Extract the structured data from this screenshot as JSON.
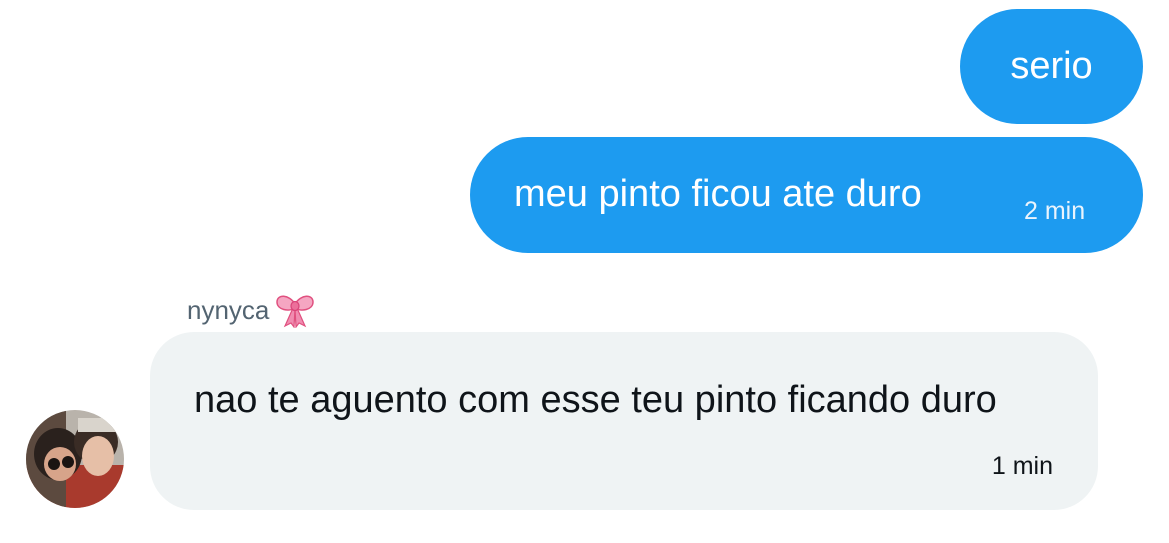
{
  "conversation": {
    "messages": [
      {
        "direction": "outgoing",
        "text": "serio",
        "time": ""
      },
      {
        "direction": "outgoing",
        "text": "meu pinto ficou ate duro",
        "time": "2 min"
      },
      {
        "direction": "incoming",
        "sender": "nynyca",
        "text": "nao te aguento com esse teu pinto ficando duro",
        "time": "1 min"
      }
    ],
    "sender_emoji": "bow-emoji-icon"
  },
  "colors": {
    "outgoing_bubble": "#1d9bf0",
    "incoming_bubble": "#eff3f4",
    "sender_name": "#536471",
    "text_dark": "#0f1419"
  }
}
